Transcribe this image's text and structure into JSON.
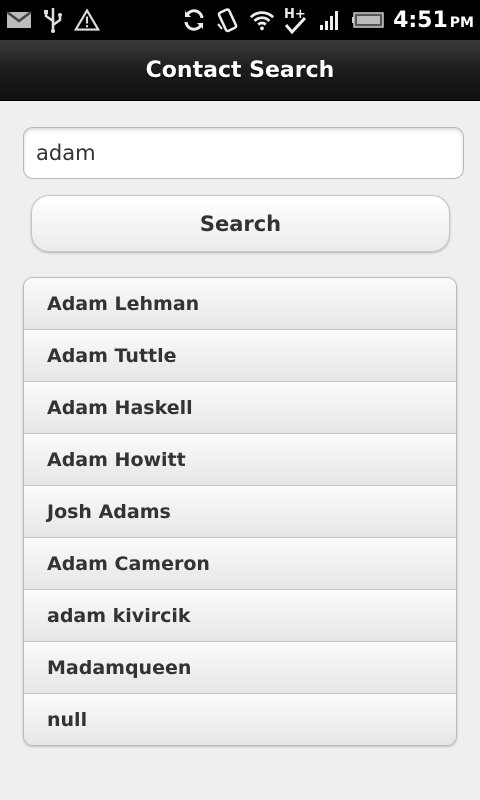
{
  "status_bar": {
    "time": "4:51",
    "ampm": "PM",
    "icons": [
      "gmail-icon",
      "usb-icon",
      "warning-icon",
      "sync-icon",
      "rotate-icon",
      "wifi-icon",
      "hsdpa-plus-icon",
      "signal-icon",
      "battery-icon"
    ]
  },
  "header": {
    "title": "Contact Search"
  },
  "search": {
    "value": "adam",
    "button_label": "Search"
  },
  "results": [
    "Adam Lehman",
    "Adam Tuttle",
    "Adam Haskell",
    "Adam Howitt",
    "Josh Adams",
    "Adam Cameron",
    "adam kivircik",
    "Madamqueen",
    "null"
  ]
}
